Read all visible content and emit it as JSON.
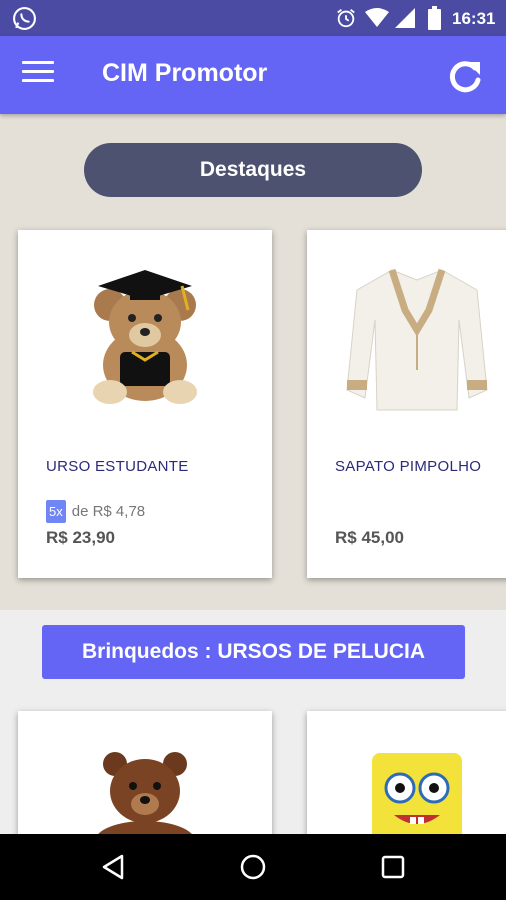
{
  "status_bar": {
    "time": "16:31",
    "icons": [
      "whatsapp-icon",
      "alarm-icon",
      "wifi-icon",
      "signal-icon",
      "battery-icon"
    ]
  },
  "app_bar": {
    "title": "CIM Promotor",
    "icons": [
      "menu-icon",
      "refresh-icon"
    ]
  },
  "featured": {
    "heading": "Destaques",
    "products": [
      {
        "name": "URSO ESTUDANTE",
        "installment_badge": "5x",
        "installment_text": "de R$ 4,78",
        "price": "R$ 23,90",
        "image": "graduation-teddy-bear"
      },
      {
        "name": "SAPATO PIMPOLHO",
        "price": "R$ 45,00",
        "image": "white-embroidered-blouse"
      }
    ]
  },
  "category": {
    "heading": "Brinquedos : URSOS DE PELUCIA",
    "products": [
      {
        "image": "brown-teddy-bear"
      },
      {
        "image": "spongebob-plush"
      }
    ]
  },
  "nav_bar": {
    "icons": [
      "back-icon",
      "home-icon",
      "recents-icon"
    ]
  },
  "colors": {
    "status_bar": "#4b4ba4",
    "app_bar": "#6565f5",
    "pill": "#4d5270",
    "category_button": "#6565f5",
    "product_name": "#2a2a7a",
    "badge": "#6f86f4"
  }
}
